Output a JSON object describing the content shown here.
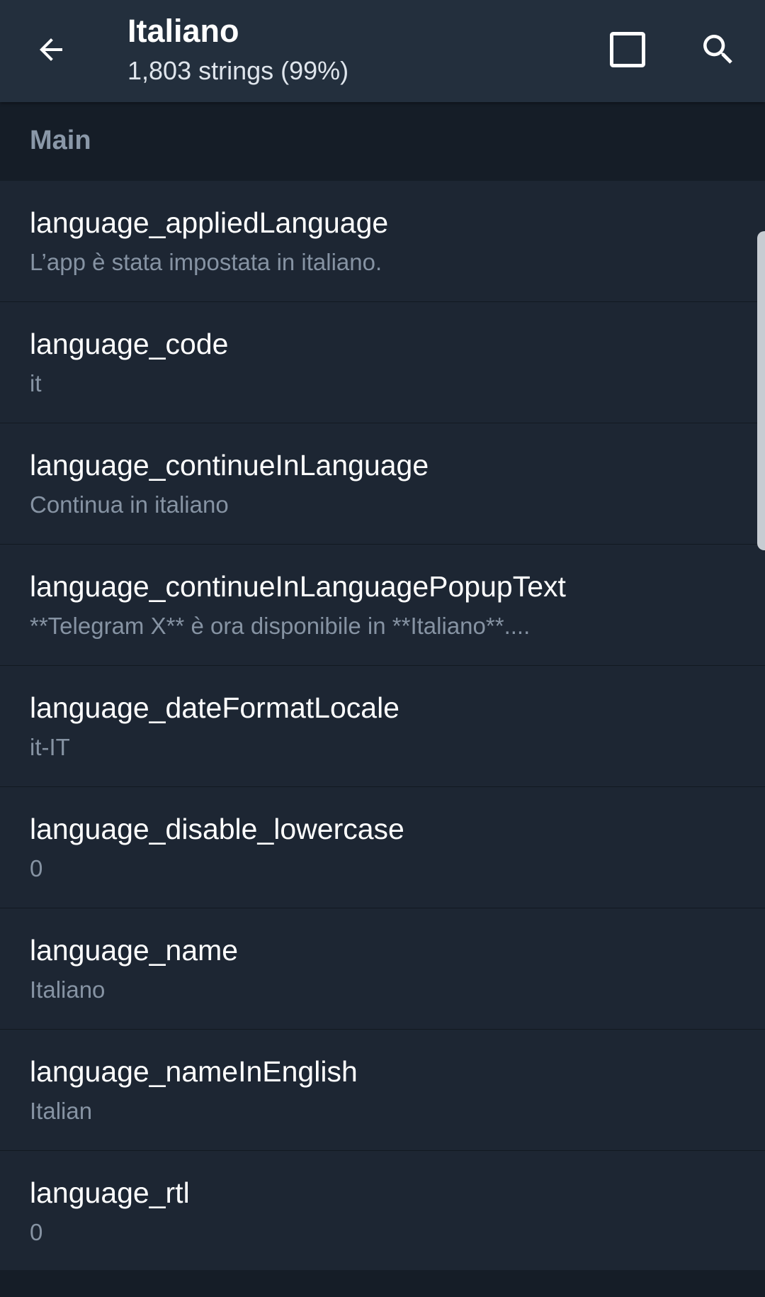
{
  "header": {
    "title": "Italiano",
    "subtitle": "1,803 strings (99%)",
    "back_icon": "arrow-back-icon",
    "square_icon": "square-outline-icon",
    "search_icon": "search-icon"
  },
  "section": {
    "title": "Main"
  },
  "strings": [
    {
      "key": "language_appliedLanguage",
      "value": "L’app è stata impostata in italiano."
    },
    {
      "key": "language_code",
      "value": "it"
    },
    {
      "key": "language_continueInLanguage",
      "value": "Continua in italiano"
    },
    {
      "key": "language_continueInLanguagePopupText",
      "value": "**Telegram X** è ora disponibile in **Italiano**...."
    },
    {
      "key": "language_dateFormatLocale",
      "value": "it-IT"
    },
    {
      "key": "language_disable_lowercase",
      "value": "0"
    },
    {
      "key": "language_name",
      "value": "Italiano"
    },
    {
      "key": "language_nameInEnglish",
      "value": "Italian"
    },
    {
      "key": "language_rtl",
      "value": "0"
    }
  ],
  "colors": {
    "appbar": "#232f3d",
    "background": "#1d2633",
    "section_header": "#151d27",
    "primary_text": "#ffffff",
    "secondary_text": "#8693a3"
  }
}
